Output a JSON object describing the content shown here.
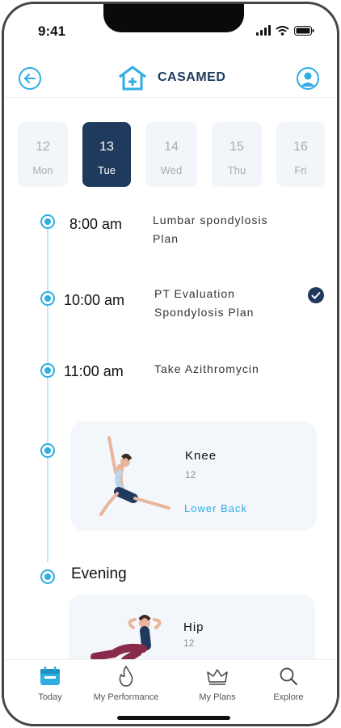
{
  "status": {
    "time": "9:41"
  },
  "header": {
    "brand": "CASAMED"
  },
  "dates": [
    {
      "num": "12",
      "day": "Mon",
      "active": false
    },
    {
      "num": "13",
      "day": "Tue",
      "active": true
    },
    {
      "num": "14",
      "day": "Wed",
      "active": false
    },
    {
      "num": "15",
      "day": "Thu",
      "active": false
    },
    {
      "num": "16",
      "day": "Fri",
      "active": false
    }
  ],
  "timeline": [
    {
      "time": "8:00 am",
      "title_line1": "Lumbar spondylosis",
      "title_line2": "Plan",
      "done": false
    },
    {
      "time": "10:00 am",
      "title_line1": "PT Evaluation",
      "title_line2": "Spondylosis Plan",
      "done": true
    },
    {
      "time": "11:00 am",
      "title_line1": "Take Azithromycin",
      "title_line2": "",
      "done": false
    }
  ],
  "cards": [
    {
      "title": "Knee",
      "count": "12",
      "link": "Lower Back"
    },
    {
      "title": "Hip",
      "count": "12"
    }
  ],
  "section": {
    "evening": "Evening"
  },
  "nav": [
    {
      "label": "Today",
      "icon": "calendar-icon",
      "active": true
    },
    {
      "label": "My Performance",
      "icon": "flame-icon",
      "active": false
    },
    {
      "label": "My Plans",
      "icon": "crown-icon",
      "active": false
    },
    {
      "label": "Explore",
      "icon": "search-icon",
      "active": false
    }
  ],
  "colors": {
    "accent": "#2eaee3",
    "navy": "#1f3a5c",
    "card_bg": "#f3f7fb",
    "dot": "#2eaee3"
  }
}
